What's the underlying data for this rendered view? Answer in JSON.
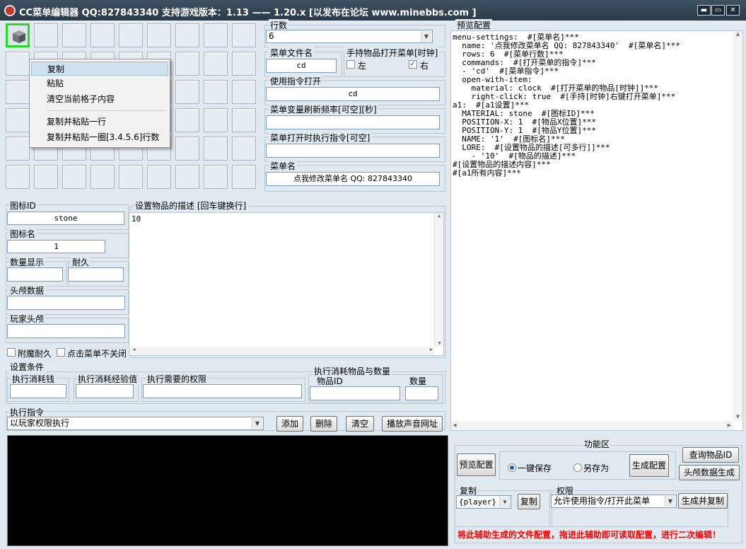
{
  "window": {
    "title": "CC菜单编辑器    QQ:827843340    支持游戏版本：1.13 —— 1.20.x  [以发布在论坛 www.minebbs.com ]",
    "min": "▬",
    "max": "▭",
    "close": "✕"
  },
  "context_menu": {
    "items": [
      "复制",
      "粘贴",
      "清空当前格子内容",
      "复制并粘贴一行",
      "复制并粘贴一圈[3.4.5.6]行数"
    ]
  },
  "settings": {
    "rows_label": "行数",
    "rows_value": "6",
    "file_label": "菜单文件名",
    "file_value": "cd",
    "item_open_label": "手持物品打开菜单[时钟]",
    "left_label": "左",
    "right_label": "右",
    "command_label": "使用指令打开",
    "command_value": "cd",
    "refresh_label": "菜单变量刷新频率[可空][秒]",
    "refresh_value": "",
    "exec_on_open_label": "菜单打开时执行指令[可空]",
    "exec_on_open_value": "",
    "menu_name_label": "菜单名",
    "menu_name_value": "点我修改菜单名 QQ: 827843340"
  },
  "item": {
    "icon_id_label": "图标ID",
    "icon_id_value": "stone",
    "icon_name_label": "图标名",
    "icon_name_value": "1",
    "amount_label": "数量显示",
    "durability_label": "耐久",
    "head_label": "头颅数据",
    "player_head_label": "玩家头颅",
    "desc_label": "设置物品的描述 [回车键换行]",
    "desc_value": "10",
    "enchant_label": "附魔耐久",
    "noclose_label": "点击菜单不关闭"
  },
  "conditions": {
    "label": "设置条件",
    "money_label": "执行消耗钱",
    "exp_label": "执行消耗经验值",
    "perm_label": "执行需要的权限",
    "consume_label": "执行消耗物品与数量",
    "consume_id_label": "物品ID",
    "consume_count_label": "数量"
  },
  "exec": {
    "label": "执行指令",
    "mode_value": "以玩家权限执行",
    "add": "添加",
    "delete": "删除",
    "clear": "清空",
    "sound": "播放声音网址"
  },
  "preview": {
    "label": "预览配置",
    "text": "menu-settings:  #[菜单名]***\n  name: '点我修改菜单名 QQ: 827843340'  #[菜单名]***\n  rows: 6  #[菜单行数]***\n  commands:  #[打开菜单的指令]***\n  - 'cd'  #[菜单指令]***\n  open-with-item:\n    material: clock  #[打开菜单的物品[时钟]]***\n    right-click: true  #[手持[时钟]右键打开菜单]***\na1:  #[a1设置]***\n  MATERIAL: stone  #[图标ID]***\n  POSITION-X: 1  #[物品X位置]***\n  POSITION-Y: 1  #[物品Y位置]***\n  NAME: '1'  #[图标名]***\n  LORE:  #[设置物品的描述[可多行]]***\n    - '10'  #[物品的描述]***\n#[设置物品的描述内容]***\n#[a1所有内容]***"
  },
  "functions": {
    "label": "功能区",
    "preview_btn": "预览配置",
    "one_click": "一键保存",
    "save_as": "另存为",
    "generate": "生成配置",
    "query_id": "查询物品ID",
    "head_gen": "头颅数据生成",
    "copy_label": "复制",
    "copy_value": "{player}",
    "copy_btn": "复制",
    "perm_label": "权限",
    "perm_value": "允许使用指令/打开此菜单",
    "gen_copy": "生成并复制",
    "note": "将此辅助生成的文件配置，拖进此辅助即可读取配置，进行二次编辑！",
    "note_color": "#ff0000"
  }
}
